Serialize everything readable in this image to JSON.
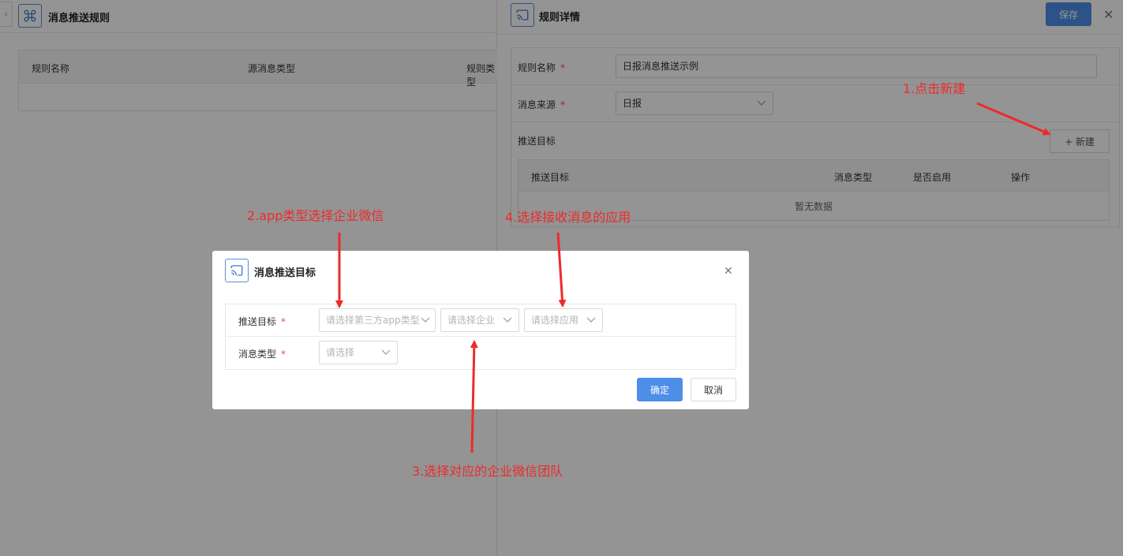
{
  "left_panel": {
    "title": "消息推送规则",
    "collapse_glyph": "‹",
    "table_headers": [
      "规则名称",
      "源消息类型",
      "规则类型"
    ]
  },
  "right_panel": {
    "title": "规则详情",
    "save_label": "保存",
    "close_glyph": "✕",
    "fields": {
      "rule_name_label": "规则名称",
      "rule_name_value": "日报消息推送示例",
      "source_label": "消息来源",
      "source_value": "日报",
      "target_label": "推送目标"
    },
    "required_mark": "*",
    "new_button_label": "+ 新建",
    "target_table": {
      "headers": [
        "推送目标",
        "消息类型",
        "是否启用",
        "操作"
      ],
      "empty_text": "暂无数据"
    }
  },
  "dialog": {
    "title": "消息推送目标",
    "close_glyph": "✕",
    "target_label": "推送目标",
    "app_type_placeholder": "请选择第三方app类型",
    "company_placeholder": "请选择企业",
    "app_placeholder": "请选择应用",
    "msg_type_label": "消息类型",
    "msg_type_placeholder": "请选择",
    "confirm_label": "确定",
    "cancel_label": "取消"
  },
  "annotations": {
    "step1": "1.点击新建",
    "step2": "2.app类型选择企业微信",
    "step3": "3.选择对应的企业微信团队",
    "step4": "4.选择接收消息的应用"
  },
  "icons": {
    "left_header_icon": "command-icon",
    "right_header_icon": "cast-icon",
    "dialog_header_icon": "cast-icon"
  },
  "colors": {
    "primary": "#4d8ee9",
    "required": "#e5533d",
    "annotation": "#ee2a2a",
    "icon_border": "#5a8fd6"
  }
}
